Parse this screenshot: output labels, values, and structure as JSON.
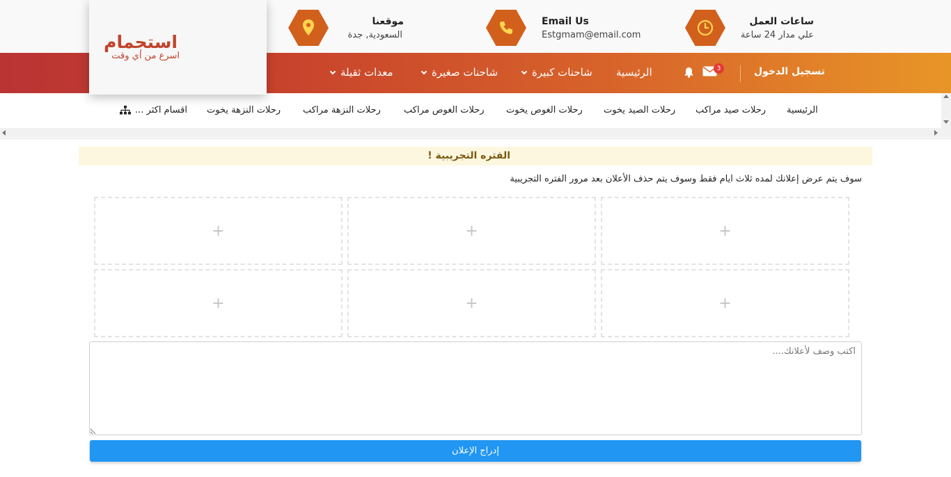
{
  "colors": {
    "accent": "#d2601d",
    "button": "#2196f3",
    "badge": "#e53935",
    "notice_bg": "#fdf7e0"
  },
  "header": {
    "hours": {
      "title": "ساعات العمل",
      "value": "علي مدار 24 ساعة",
      "icon": "clock-icon"
    },
    "email": {
      "title": "Email Us",
      "value": "Estgmam@email.com",
      "icon": "phone-icon"
    },
    "location": {
      "title": "موقعنا",
      "value": "السعودية, جدة",
      "icon": "map-pin-icon"
    }
  },
  "logo": {
    "main": "استجمام",
    "sub": "اسرع من اي وقت"
  },
  "nav": {
    "login": "تسجيل الدخول",
    "mail_count": "3",
    "items": [
      "الرئيسية",
      "شاحنات كبيرة",
      "شاحنات صغيرة",
      "معدات ثقيلة"
    ]
  },
  "submenu": {
    "items": [
      "الرئيسية",
      "رحلات صيد مراكب",
      "رحلات الصيد يخوت",
      "رحلات الغوص يخوت",
      "رحلات الغوص مراكب",
      "رحلات النزهة مراكب",
      "رحلات النزهة يخوت"
    ],
    "more": "اقسام اكثر ..."
  },
  "notice": {
    "title": "الفتره التجريبية !",
    "body": "سوف يتم عرض إعلانك لمده ثلاث ايام فقط وسوف يتم حذف الأعلان بعد مرور الفتره التجريبية"
  },
  "upload": {
    "plus": "+"
  },
  "form": {
    "description_placeholder": "اكتب وصف لأعلانك....",
    "description_value": "",
    "submit": "إدراج الإعلان"
  }
}
